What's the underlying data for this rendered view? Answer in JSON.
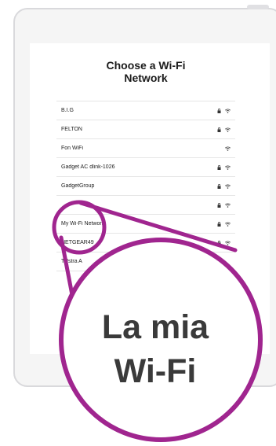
{
  "screen": {
    "title_line1": "Choose a Wi-Fi",
    "title_line2": "Network"
  },
  "networks": [
    {
      "name": "B.I.G",
      "locked": true
    },
    {
      "name": "FELTON",
      "locked": true
    },
    {
      "name": "Fon WiFi",
      "locked": false
    },
    {
      "name": "Gadget AC dlink-1026",
      "locked": true
    },
    {
      "name": "GadgetGroup",
      "locked": true
    },
    {
      "name": "",
      "locked": true
    },
    {
      "name": "My Wi-Fi Network",
      "locked": true
    },
    {
      "name": "NETGEAR49",
      "locked": true
    },
    {
      "name": "Telstra A",
      "locked": false
    }
  ],
  "callout": {
    "line1": "La mia",
    "line2": "Wi-Fi",
    "color": "#a0258f"
  },
  "icons": {
    "lock": "lock-icon",
    "wifi": "wifi-icon"
  }
}
